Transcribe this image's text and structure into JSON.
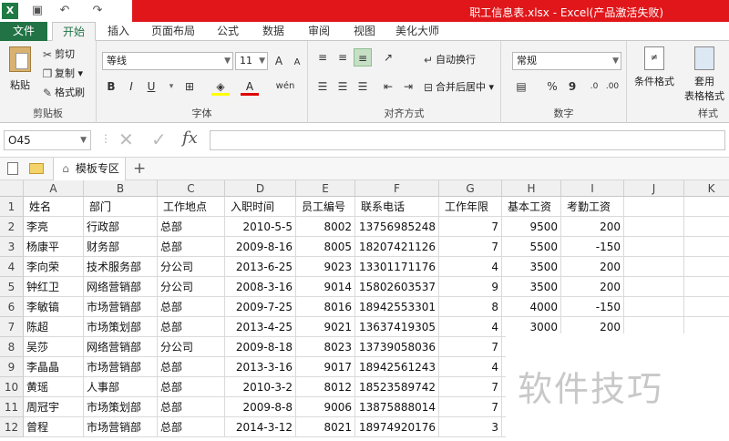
{
  "window": {
    "title": "职工信息表.xlsx - Excel(产品激活失败)",
    "app_icon": "X"
  },
  "tabs": [
    "文件",
    "开始",
    "插入",
    "页面布局",
    "公式",
    "数据",
    "审阅",
    "视图",
    "美化大师"
  ],
  "clipboard": {
    "paste": "粘贴",
    "cut": "剪切",
    "copy": "复制",
    "format_painter": "格式刷",
    "label": "剪贴板"
  },
  "font": {
    "name": "等线",
    "size": "11",
    "grow": "A",
    "shrink": "A",
    "bold": "B",
    "italic": "I",
    "underline": "U",
    "wen": "wén",
    "label": "字体"
  },
  "alignment": {
    "wrap": "自动换行",
    "merge": "合并后居中",
    "label": "对齐方式"
  },
  "number": {
    "format": "常规",
    "percent": "%",
    "comma": "9",
    "label": "数字"
  },
  "styles": {
    "conditional": "条件格式",
    "table_format_1": "套用",
    "table_format_2": "表格格式",
    "label": "样式"
  },
  "formula_bar": {
    "name_box": "O45",
    "fx": "fx",
    "value": ""
  },
  "sheetbar": {
    "template_area": "模板专区",
    "add": "+"
  },
  "columns": [
    "A",
    "B",
    "C",
    "D",
    "E",
    "F",
    "G",
    "H",
    "I",
    "J",
    "K"
  ],
  "rows": [
    [
      "姓名",
      "部门",
      "工作地点",
      "入职时间",
      "员工编号",
      "联系电话",
      "工作年限",
      "基本工资",
      "考勤工资"
    ],
    [
      "李亮",
      "行政部",
      "总部",
      "2010-5-5",
      "8002",
      "13756985248",
      "7",
      "9500",
      "200"
    ],
    [
      "杨康平",
      "财务部",
      "总部",
      "2009-8-16",
      "8005",
      "18207421126",
      "7",
      "5500",
      "-150"
    ],
    [
      "李向荣",
      "技术服务部",
      "分公司",
      "2013-6-25",
      "9023",
      "13301171176",
      "4",
      "3500",
      "200"
    ],
    [
      "钟红卫",
      "网络营销部",
      "分公司",
      "2008-3-16",
      "9014",
      "15802603537",
      "9",
      "3500",
      "200"
    ],
    [
      "李敏镐",
      "市场营销部",
      "总部",
      "2009-7-25",
      "8016",
      "18942553301",
      "8",
      "4000",
      "-150"
    ],
    [
      "陈超",
      "市场策划部",
      "总部",
      "2013-4-25",
      "9021",
      "13637419305",
      "4",
      "3000",
      "200"
    ],
    [
      "吴莎",
      "网络营销部",
      "分公司",
      "2009-8-18",
      "8023",
      "13739058036",
      "7",
      "",
      ""
    ],
    [
      "李晶晶",
      "市场营销部",
      "总部",
      "2013-3-16",
      "9017",
      "18942561243",
      "4",
      "",
      ""
    ],
    [
      "黄瑶",
      "人事部",
      "总部",
      "2010-3-2",
      "8012",
      "18523589742",
      "7",
      "",
      ""
    ],
    [
      "周冠宇",
      "市场策划部",
      "总部",
      "2009-8-8",
      "9006",
      "13875888014",
      "7",
      "",
      ""
    ],
    [
      "曾程",
      "市场营销部",
      "总部",
      "2014-3-12",
      "8021",
      "18974920176",
      "3",
      "",
      ""
    ]
  ],
  "watermark": "软件技巧"
}
